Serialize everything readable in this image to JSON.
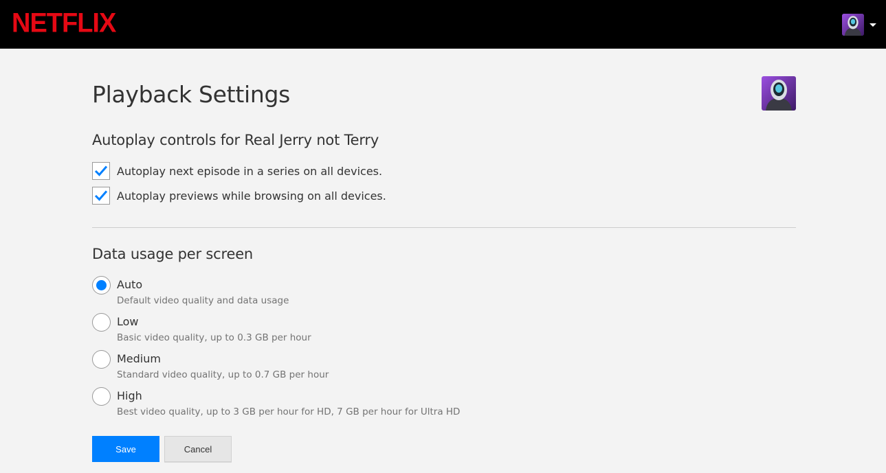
{
  "header": {
    "logo_text": "NETFLIX",
    "brand_color": "#e50914",
    "account_avatar_icon": "robot-avatar-icon",
    "account_menu_icon": "caret-down-icon"
  },
  "page": {
    "title": "Playback Settings",
    "profile_avatar_icon": "robot-avatar-icon"
  },
  "autoplay": {
    "title": "Autoplay controls for Real Jerry not Terry",
    "options": [
      {
        "label": "Autoplay next episode in a series on all devices.",
        "checked": true
      },
      {
        "label": "Autoplay previews while browsing on all devices.",
        "checked": true
      }
    ]
  },
  "data_usage": {
    "title": "Data usage per screen",
    "selected": "Auto",
    "options": [
      {
        "label": "Auto",
        "description": "Default video quality and data usage"
      },
      {
        "label": "Low",
        "description": "Basic video quality, up to 0.3 GB per hour"
      },
      {
        "label": "Medium",
        "description": "Standard video quality, up to 0.7 GB per hour"
      },
      {
        "label": "High",
        "description": "Best video quality, up to 3 GB per hour for HD, 7 GB per hour for Ultra HD"
      }
    ]
  },
  "actions": {
    "save_label": "Save",
    "cancel_label": "Cancel",
    "accent_color": "#0080ff"
  }
}
